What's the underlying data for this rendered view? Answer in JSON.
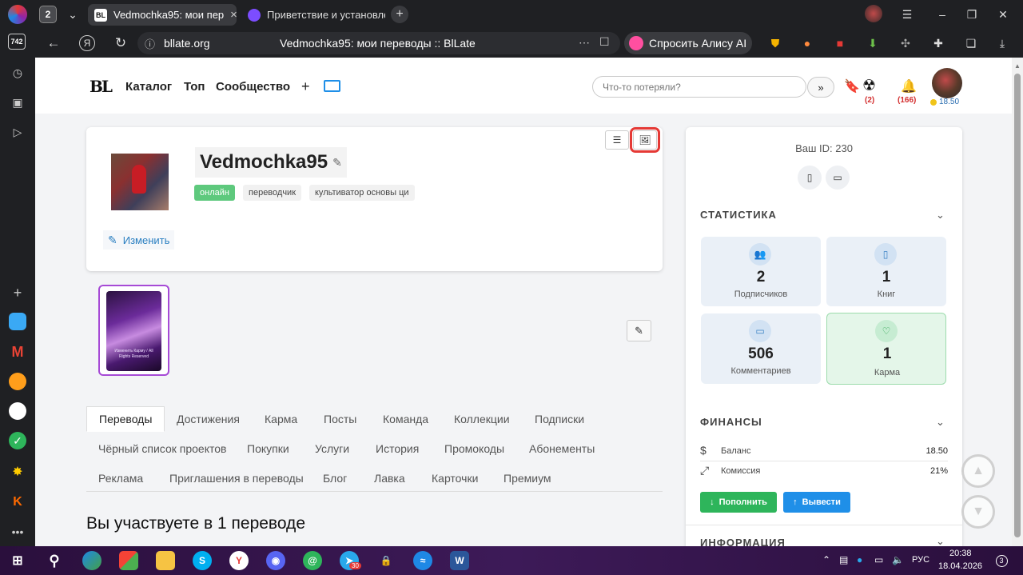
{
  "browser": {
    "tab_count": "2",
    "tabs": [
      {
        "favicon": "BL",
        "title": "Vedmochka95: мои пер"
      },
      {
        "favicon": "",
        "title": "Приветствие и установле"
      }
    ],
    "url": "bllate.org",
    "page_title": "Vedmochka95: мои переводы :: BlLate",
    "alisa_label": "Спросить Алису AI",
    "rail_badge": "742"
  },
  "site": {
    "logo": "BL",
    "nav": [
      "Каталог",
      "Топ",
      "Сообщество"
    ],
    "plus": "+",
    "search_placeholder": "Что-то потеряли?",
    "search_button": "»",
    "radiation_count": "(2)",
    "bell_count": "(166)",
    "balance_short": "18.50"
  },
  "profile": {
    "name": "Vedmochka95",
    "status": "онлайн",
    "tags": [
      "переводчик",
      "культиватор основы ци"
    ],
    "edit_label": "Изменить",
    "cover_text": "Изменить Карму / All Rights Reserved"
  },
  "tabs": {
    "row1": [
      "Переводы",
      "Достижения",
      "Карма",
      "Посты",
      "Команда",
      "Коллекции",
      "Подписки"
    ],
    "row2": [
      "Чёрный список проектов",
      "Покупки",
      "Услуги",
      "История",
      "Промокоды",
      "Абонементы"
    ],
    "row3": [
      "Реклама",
      "Приглашения в переводы",
      "Блог",
      "Лавка",
      "Карточки",
      "Премиум"
    ],
    "active": "Переводы"
  },
  "section_heading": "Вы участвуете в 1 переводе",
  "sidebar": {
    "your_id": "Ваш ID: 230",
    "stats_title": "СТАТИСТИКА",
    "stats": [
      {
        "value": "2",
        "label": "Подписчиков",
        "icon": "users-icon"
      },
      {
        "value": "1",
        "label": "Книг",
        "icon": "book-icon"
      },
      {
        "value": "506",
        "label": "Комментариев",
        "icon": "comment-icon"
      },
      {
        "value": "1",
        "label": "Карма",
        "icon": "heart-icon"
      }
    ],
    "finance_title": "ФИНАНСЫ",
    "balance_label": "Баланс",
    "balance_value": "18.50",
    "commission_label": "Комиссия",
    "commission_value": "21%",
    "topup_label": "Пополнить",
    "withdraw_label": "Вывести",
    "info_title": "ИНФОРМАЦИЯ"
  },
  "taskbar": {
    "telegram_badge": "30",
    "language": "РУС",
    "time": "20:38",
    "date": "18.04.2026",
    "notifications": "3"
  }
}
